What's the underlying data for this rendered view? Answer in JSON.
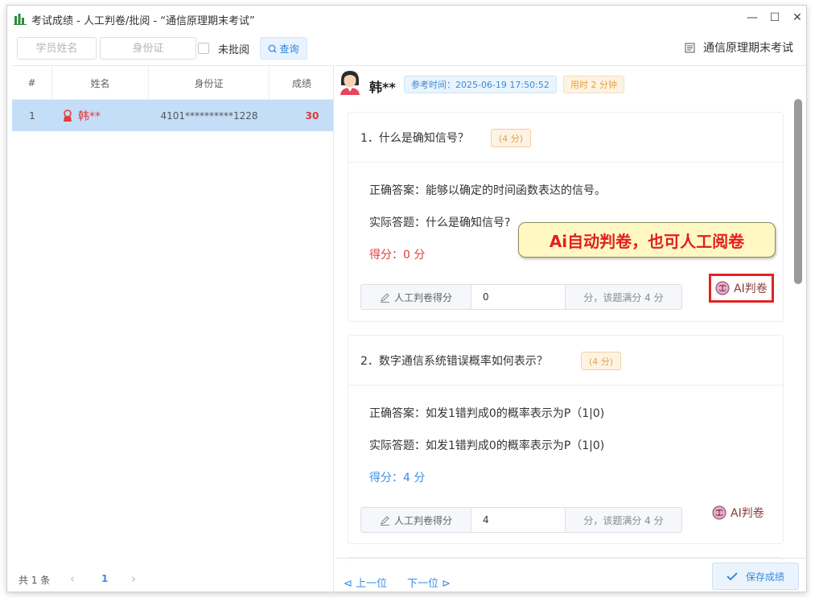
{
  "window": {
    "title": "考试成绩 - 人工判卷/批阅 - “通信原理期末考试”",
    "buttons": {
      "minimize": "—",
      "maximize": "☐",
      "close": "✕"
    }
  },
  "toolbar": {
    "name_placeholder": "学员姓名",
    "id_placeholder": "身份证",
    "unreviewed_label": "未批阅",
    "query_label": "查询",
    "exam_title": "通信原理期末考试"
  },
  "table": {
    "headers": [
      "#",
      "姓名",
      "身份证",
      "成绩"
    ],
    "rows": [
      {
        "index": "1",
        "name": "韩**",
        "id": "4101**********1228",
        "score": "30"
      }
    ]
  },
  "pager": {
    "total": "共 1 条",
    "prev": "‹",
    "page": "1",
    "next": "›"
  },
  "student": {
    "name": "韩**",
    "exam_time": "参考时间：2025-06-19 17:50:52",
    "duration": "用时 2 分钟"
  },
  "questions": [
    {
      "title": "1．什么是确知信号？",
      "points": "(4 分)",
      "correct": "正确答案：能够以确定的时间函数表达的信号。",
      "actual": "实际答题：什么是确知信号?",
      "score": "得分：0 分",
      "grade_label": "人工判卷得分",
      "grade_value": "0",
      "grade_suffix": "分，该题满分 4 分",
      "ai_label": "AI判卷"
    },
    {
      "title": "2．数字通信系统错误概率如何表示？",
      "points": "(4 分)",
      "correct": "正确答案：如发1错判成0的概率表示为P（1|0)",
      "actual": "实际答题：如发1错判成0的概率表示为P（1|0)",
      "score": "得分：4 分",
      "grade_label": "人工判卷得分",
      "grade_value": "4",
      "grade_suffix": "分，该题满分 4 分",
      "ai_label": "AI判卷"
    }
  ],
  "callout": "Ai自动判卷，也可人工阅卷",
  "footer": {
    "prev": "上一位",
    "next": "下一位",
    "save": "保存成绩"
  },
  "colors": {
    "accent": "#3a8ee6",
    "danger": "#e03a3a",
    "warning": "#e6a23c",
    "selected_row": "#c4def8"
  }
}
